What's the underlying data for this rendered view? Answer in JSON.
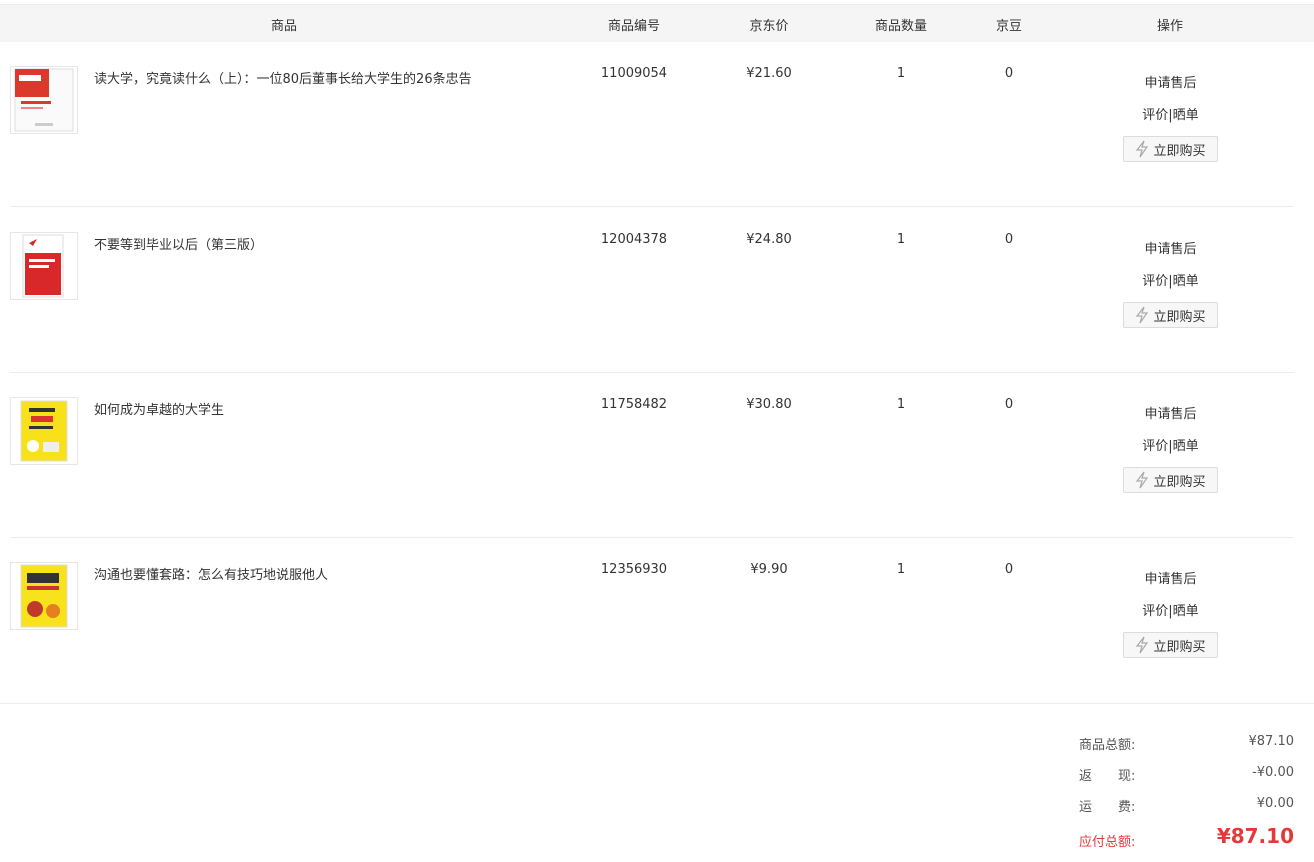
{
  "table_header": {
    "product": "商品",
    "sku": "商品编号",
    "price": "京东价",
    "quantity": "商品数量",
    "jingdou": "京豆",
    "actions": "操作"
  },
  "items": [
    {
      "name": "读大学，究竟读什么（上）：一位80后董事长给大学生的26条忠告",
      "sku": "11009054",
      "price": "¥21.60",
      "quantity": "1",
      "jingdou": "0",
      "after_sale": "申请售后",
      "review": "评价|晒单",
      "buy_again": "立即购买"
    },
    {
      "name": "不要等到毕业以后（第三版）",
      "sku": "12004378",
      "price": "¥24.80",
      "quantity": "1",
      "jingdou": "0",
      "after_sale": "申请售后",
      "review": "评价|晒单",
      "buy_again": "立即购买"
    },
    {
      "name": "如何成为卓越的大学生",
      "sku": "11758482",
      "price": "¥30.80",
      "quantity": "1",
      "jingdou": "0",
      "after_sale": "申请售后",
      "review": "评价|晒单",
      "buy_again": "立即购买"
    },
    {
      "name": "沟通也要懂套路：怎么有技巧地说服他人",
      "sku": "12356930",
      "price": "¥9.90",
      "quantity": "1",
      "jingdou": "0",
      "after_sale": "申请售后",
      "review": "评价|晒单",
      "buy_again": "立即购买"
    }
  ],
  "summary": {
    "goods_total_label": "商品总额:",
    "goods_total_value": "¥87.10",
    "rebate_label": "返　　现:",
    "rebate_value": "-¥0.00",
    "shipping_label": "运　　费:",
    "shipping_value": "¥0.00",
    "payable_label": "应付总额:",
    "payable_value": "¥87.10"
  },
  "colors": {
    "accent_red": "#e4393c",
    "header_bg": "#f5f5f5",
    "border": "#ececec"
  }
}
